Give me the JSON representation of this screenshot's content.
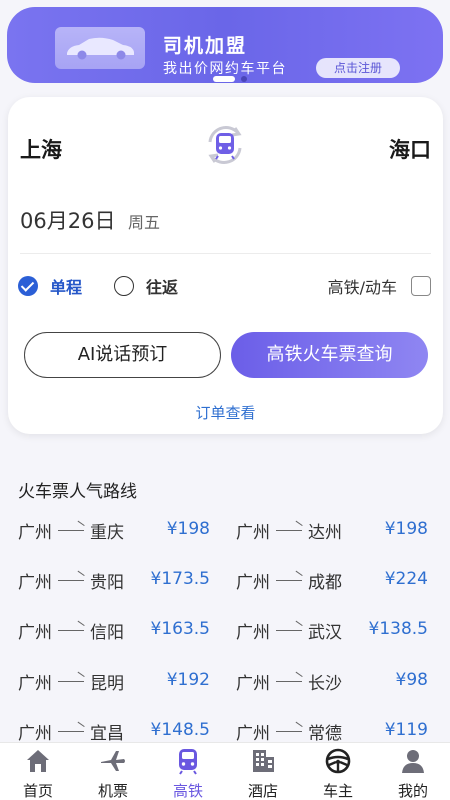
{
  "banner": {
    "title": "司机加盟",
    "subtitle": "我出价网约车平台",
    "button": "点击注册"
  },
  "booking": {
    "from_city": "上海",
    "to_city": "海口",
    "date": "06月26日",
    "weekday": "周五",
    "trip_oneway": "单程",
    "trip_round": "往返",
    "train_filter": "高铁/动车",
    "ai_button": "AI说话预订",
    "query_button": "高铁火车票查询",
    "orders_link": "订单查看"
  },
  "routes": {
    "title": "火车票人气路线",
    "items": [
      {
        "from": "广州",
        "to": "重庆",
        "price": "¥198"
      },
      {
        "from": "广州",
        "to": "达州",
        "price": "¥198"
      },
      {
        "from": "广州",
        "to": "贵阳",
        "price": "¥173.5"
      },
      {
        "from": "广州",
        "to": "成都",
        "price": "¥224"
      },
      {
        "from": "广州",
        "to": "信阳",
        "price": "¥163.5"
      },
      {
        "from": "广州",
        "to": "武汉",
        "price": "¥138.5"
      },
      {
        "from": "广州",
        "to": "昆明",
        "price": "¥192"
      },
      {
        "from": "广州",
        "to": "长沙",
        "price": "¥98"
      },
      {
        "from": "广州",
        "to": "宜昌",
        "price": "¥148.5"
      },
      {
        "from": "广州",
        "to": "常德",
        "price": "¥119"
      }
    ]
  },
  "tabs": [
    {
      "label": "首页",
      "icon": "home-icon"
    },
    {
      "label": "机票",
      "icon": "plane-icon"
    },
    {
      "label": "高铁",
      "icon": "train-icon"
    },
    {
      "label": "酒店",
      "icon": "hotel-icon"
    },
    {
      "label": "车主",
      "icon": "steering-wheel-icon"
    },
    {
      "label": "我的",
      "icon": "user-icon"
    }
  ],
  "colors": {
    "accent": "#6a58e0",
    "link": "#2f6fd0",
    "banner": "#6a66e8"
  }
}
